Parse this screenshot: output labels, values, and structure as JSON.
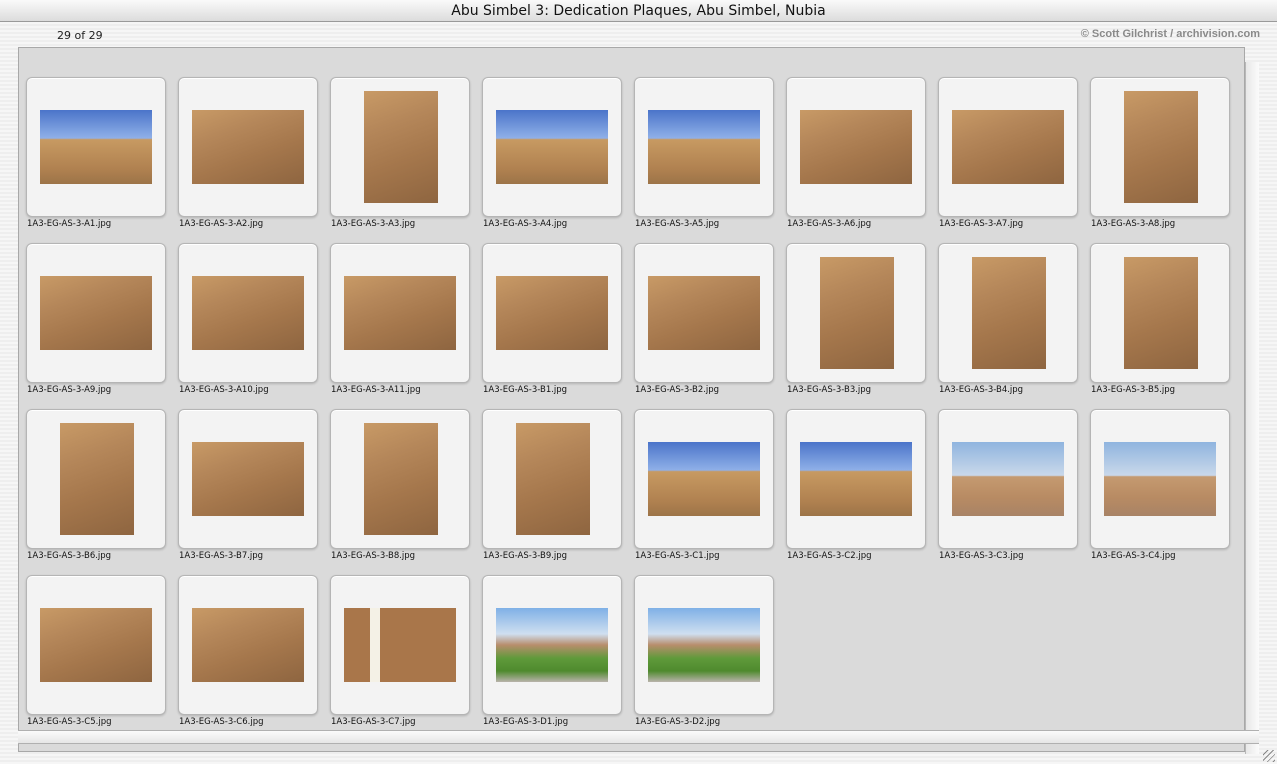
{
  "window": {
    "title": "Abu Simbel 3: Dedication Plaques, Abu Simbel, Nubia"
  },
  "header": {
    "count": "29 of 29",
    "copyright": "© Scott Gilchrist / archivision.com"
  },
  "thumbnails": [
    {
      "name": "1A3-EG-AS-3-A1.jpg",
      "shape": "land",
      "style": "sky"
    },
    {
      "name": "1A3-EG-AS-3-A2.jpg",
      "shape": "land",
      "style": "stone"
    },
    {
      "name": "1A3-EG-AS-3-A3.jpg",
      "shape": "port",
      "style": "stone"
    },
    {
      "name": "1A3-EG-AS-3-A4.jpg",
      "shape": "land",
      "style": "sky"
    },
    {
      "name": "1A3-EG-AS-3-A5.jpg",
      "shape": "land",
      "style": "sky"
    },
    {
      "name": "1A3-EG-AS-3-A6.jpg",
      "shape": "land",
      "style": "stone"
    },
    {
      "name": "1A3-EG-AS-3-A7.jpg",
      "shape": "land",
      "style": "stone"
    },
    {
      "name": "1A3-EG-AS-3-A8.jpg",
      "shape": "port",
      "style": "stone"
    },
    {
      "name": "1A3-EG-AS-3-A9.jpg",
      "shape": "land",
      "style": "stone"
    },
    {
      "name": "1A3-EG-AS-3-A10.jpg",
      "shape": "land",
      "style": "stone"
    },
    {
      "name": "1A3-EG-AS-3-A11.jpg",
      "shape": "land",
      "style": "stone"
    },
    {
      "name": "1A3-EG-AS-3-B1.jpg",
      "shape": "land",
      "style": "stone"
    },
    {
      "name": "1A3-EG-AS-3-B2.jpg",
      "shape": "land",
      "style": "stone"
    },
    {
      "name": "1A3-EG-AS-3-B3.jpg",
      "shape": "port",
      "style": "stone"
    },
    {
      "name": "1A3-EG-AS-3-B4.jpg",
      "shape": "port",
      "style": "stone"
    },
    {
      "name": "1A3-EG-AS-3-B5.jpg",
      "shape": "port",
      "style": "stone"
    },
    {
      "name": "1A3-EG-AS-3-B6.jpg",
      "shape": "port",
      "style": "stone"
    },
    {
      "name": "1A3-EG-AS-3-B7.jpg",
      "shape": "land",
      "style": "stone"
    },
    {
      "name": "1A3-EG-AS-3-B8.jpg",
      "shape": "port",
      "style": "stone"
    },
    {
      "name": "1A3-EG-AS-3-B9.jpg",
      "shape": "port",
      "style": "stone"
    },
    {
      "name": "1A3-EG-AS-3-C1.jpg",
      "shape": "land",
      "style": "sky"
    },
    {
      "name": "1A3-EG-AS-3-C2.jpg",
      "shape": "land",
      "style": "sky"
    },
    {
      "name": "1A3-EG-AS-3-C3.jpg",
      "shape": "land",
      "style": "desert"
    },
    {
      "name": "1A3-EG-AS-3-C4.jpg",
      "shape": "land",
      "style": "desert"
    },
    {
      "name": "1A3-EG-AS-3-C5.jpg",
      "shape": "land",
      "style": "stone"
    },
    {
      "name": "1A3-EG-AS-3-C6.jpg",
      "shape": "land",
      "style": "stone"
    },
    {
      "name": "1A3-EG-AS-3-C7.jpg",
      "shape": "land",
      "style": "plaque"
    },
    {
      "name": "1A3-EG-AS-3-D1.jpg",
      "shape": "land",
      "style": "garden"
    },
    {
      "name": "1A3-EG-AS-3-D2.jpg",
      "shape": "land",
      "style": "garden"
    }
  ]
}
